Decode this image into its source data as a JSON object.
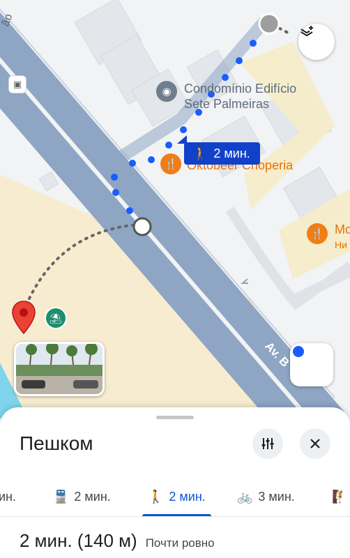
{
  "map": {
    "street_partial_top": "ão",
    "street_name": "Av. Bartolomeu Mitre",
    "street_visible": "Av. B   olo",
    "place_condo": "Condomínio Edifício\nSete Palmeiras",
    "place_condo_line1": "Condomínio Edifício",
    "place_condo_line2": "Sete Palmeiras",
    "place_restaurant": "Oktobeer Choperia",
    "place_right_partial_1": "Mo",
    "place_right_partial_2": "Ни",
    "route_time_chip": "2 мин.",
    "icons": [
      "layers-icon",
      "bus-stop-icon",
      "restaurant-icon",
      "walking-icon",
      "my-location-icon",
      "pin-icon",
      "beach-icon"
    ],
    "colors": {
      "route": "#1a5cff",
      "road": "#8fa6c6",
      "restaurant": "#f07d16",
      "pin": "#ea4335"
    }
  },
  "sheet": {
    "title": "Пешком",
    "filter_icon": "tune-icon",
    "close_icon": "close-icon",
    "modes": [
      {
        "id": "car",
        "label": "ин.",
        "icon": "car-icon"
      },
      {
        "id": "transit",
        "label": "2 мин.",
        "icon": "train-icon"
      },
      {
        "id": "walk",
        "label": "2 мин.",
        "icon": "walking-icon",
        "active": true
      },
      {
        "id": "bike",
        "label": "3 мин.",
        "icon": "bike-icon"
      },
      {
        "id": "more",
        "label": "",
        "icon": "hike-icon"
      }
    ],
    "summary_time": "2 мин. (140 м)",
    "summary_note": "Почти ровно",
    "accent": "#0b57d0"
  }
}
